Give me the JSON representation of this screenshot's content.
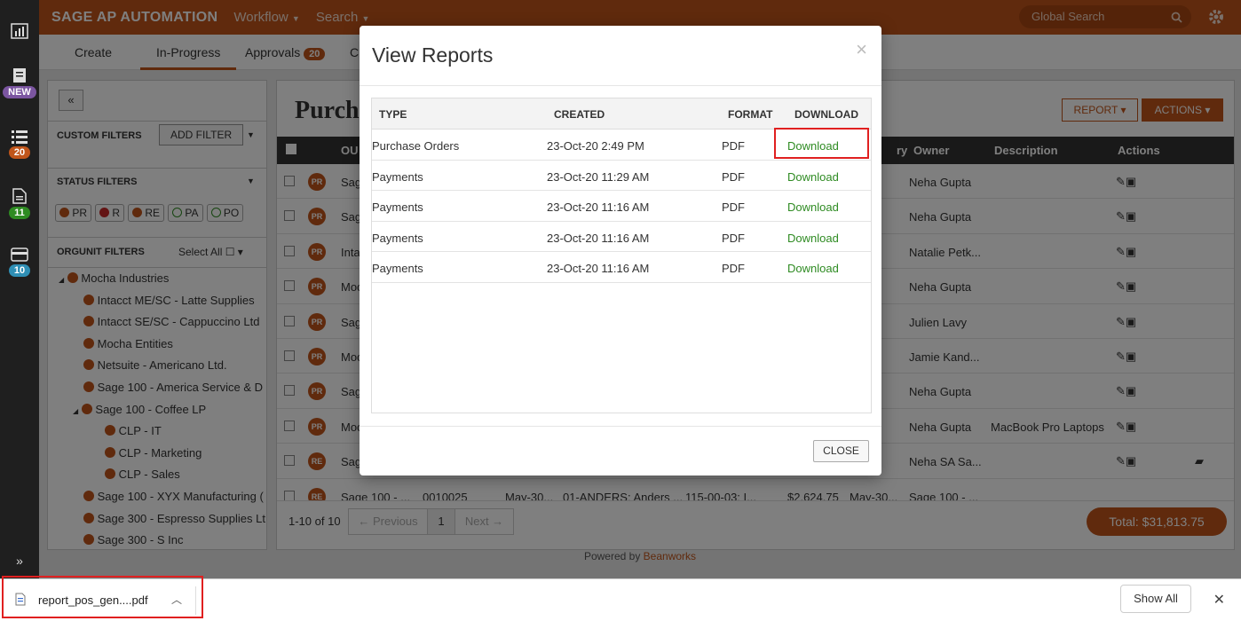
{
  "app": {
    "brand": "SAGE AP AUTOMATION",
    "nav": [
      "Workflow",
      "Search"
    ],
    "global_search_placeholder": "Global Search"
  },
  "rail": {
    "new_label": "NEW",
    "badges": [
      "20",
      "11",
      "10"
    ]
  },
  "tabs": [
    {
      "label": "Create"
    },
    {
      "label": "In-Progress"
    },
    {
      "label": "Approvals",
      "count": "20"
    },
    {
      "label": "C"
    }
  ],
  "filters": {
    "custom": "CUSTOM FILTERS",
    "add": "ADD FILTER",
    "status": "STATUS FILTERS",
    "chips": [
      "PR",
      "R",
      "RE",
      "PA",
      "PO"
    ],
    "orgunit": "ORGUNIT FILTERS",
    "select_all": "Select All"
  },
  "orgtree": [
    "Mocha Industries",
    "Intacct ME/SC - Latte Supplies",
    "Intacct SE/SC - Cappuccino Ltd",
    "Mocha Entities",
    "Netsuite - Americano Ltd.",
    "Sage 100 - America Service & D",
    "Sage 100 - Coffee LP",
    "CLP - IT",
    "CLP - Marketing",
    "CLP - Sales",
    "Sage 100 - XYX Manufacturing (",
    "Sage 300 - Espresso Supplies Lt",
    "Sage 300 - S Inc"
  ],
  "main": {
    "title_partial": "Purch",
    "report_btn": "REPORT",
    "actions_btn": "ACTIONS",
    "columns": {
      "ou": "OU",
      "ry": "ry",
      "owner": "Owner",
      "description": "Description",
      "actions": "Actions"
    },
    "rows": [
      {
        "badge": "PR",
        "ou": "Sag",
        "owner": "Neha Gupta",
        "desc": ""
      },
      {
        "badge": "PR",
        "ou": "Sag",
        "owner": "Neha Gupta",
        "desc": ""
      },
      {
        "badge": "PR",
        "ou": "Inta",
        "owner": "Natalie Petk...",
        "desc": ""
      },
      {
        "badge": "PR",
        "ou": "Moc",
        "owner": "Neha Gupta",
        "desc": ""
      },
      {
        "badge": "PR",
        "ou": "Sag",
        "owner": "Julien Lavy",
        "desc": ""
      },
      {
        "badge": "PR",
        "ou": "Moc",
        "owner": "Jamie Kand...",
        "desc": ""
      },
      {
        "badge": "PR",
        "ou": "Sag",
        "owner": "Neha Gupta",
        "desc": ""
      },
      {
        "badge": "PR",
        "ou": "Moc",
        "owner": "Neha Gupta",
        "desc": "MacBook Pro Laptops"
      },
      {
        "badge": "RE",
        "ou": "Sag",
        "owner": "Neha SA Sa...",
        "desc": ""
      }
    ],
    "last_row": [
      "Sage 100 - ...",
      "0010025",
      "May-30...",
      "01-ANDERS: Anders ...",
      "115-00-03: I...",
      "$2,624.75",
      "May-30...",
      "Sage 100 - ..."
    ],
    "pagination": {
      "count": "1-10 of 10",
      "prev": "← Previous",
      "page": "1",
      "next": "Next →"
    },
    "total": "Total: $31,813.75"
  },
  "modal": {
    "title": "View Reports",
    "close_x": "×",
    "headers": [
      "TYPE",
      "CREATED",
      "FORMAT",
      "DOWNLOAD"
    ],
    "reports": [
      {
        "type": "Purchase Orders",
        "created": "23-Oct-20 2:49 PM",
        "format": "PDF",
        "link": "Download"
      },
      {
        "type": "Payments",
        "created": "23-Oct-20 11:29 AM",
        "format": "PDF",
        "link": "Download"
      },
      {
        "type": "Payments",
        "created": "23-Oct-20 11:16 AM",
        "format": "PDF",
        "link": "Download"
      },
      {
        "type": "Payments",
        "created": "23-Oct-20 11:16 AM",
        "format": "PDF",
        "link": "Download"
      },
      {
        "type": "Payments",
        "created": "23-Oct-20 11:16 AM",
        "format": "PDF",
        "link": "Download"
      }
    ],
    "close_btn": "CLOSE"
  },
  "footer": {
    "powered": "Powered by",
    "brand": "Beanworks"
  },
  "downloads": {
    "file": "report_pos_gen....pdf",
    "show_all": "Show All"
  }
}
